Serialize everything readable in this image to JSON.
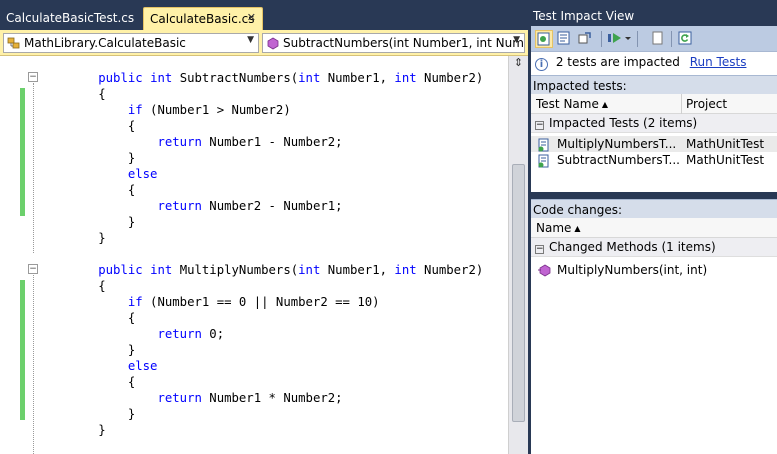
{
  "editor": {
    "tabs": [
      {
        "label": "CalculateBasicTest.cs",
        "active": false
      },
      {
        "label": "CalculateBasic.cs",
        "active": true
      }
    ],
    "tab_close_glyph": "✕",
    "nav": {
      "class_combo": "MathLibrary.CalculateBasic",
      "member_combo": "SubtractNumbers(int Number1, int Numb"
    },
    "code_lines": [
      "        public int SubtractNumbers(int Number1, int Number2)",
      "        {",
      "            if (Number1 > Number2)",
      "            {",
      "                return Number1 - Number2;",
      "            }",
      "            else",
      "            {",
      "                return Number2 - Number1;",
      "            }",
      "        }",
      "",
      "        public int MultiplyNumbers(int Number1, int Number2)",
      "        {",
      "            if (Number1 == 0 || Number2 == 10)",
      "            {",
      "                return 0;",
      "            }",
      "            else",
      "            {",
      "                return Number1 * Number2;",
      "            }",
      "        }"
    ],
    "keywords": [
      "public",
      "int",
      "if",
      "return",
      "else"
    ],
    "colors": {
      "keyword": "#0000ff",
      "changed_marker": "#6cd06c",
      "active_tab": "#fff1a8",
      "chrome": "#293955"
    }
  },
  "panel": {
    "title": "Test Impact View",
    "info": {
      "icon": "info-icon",
      "icon_glyph": "i",
      "message": "2 tests are impacted",
      "link": "Run Tests"
    },
    "impacted_tests": {
      "section_label": "Impacted tests:",
      "columns": [
        "Test Name",
        "Project"
      ],
      "sort_glyph": "▲",
      "group_label": "Impacted Tests (2 items)",
      "group_glyph": "−",
      "rows": [
        {
          "name": "MultiplyNumbersT...",
          "project": "MathUnitTest",
          "icon": "test-icon"
        },
        {
          "name": "SubtractNumbersT...",
          "project": "MathUnitTest",
          "icon": "test-icon"
        }
      ]
    },
    "code_changes": {
      "section_label": "Code changes:",
      "columns": [
        "Name"
      ],
      "sort_glyph": "▲",
      "group_label": "Changed Methods (1 items)",
      "group_glyph": "−",
      "rows": [
        {
          "name": "MultiplyNumbers(int, int)",
          "icon": "method-icon"
        }
      ]
    },
    "toolbar_icons": [
      "show-impacted-tests-icon",
      "show-code-changes-icon",
      "show-call-hierarchy-icon",
      "run-tests-icon",
      "dropdown-icon",
      "copy-icon",
      "refresh-icon"
    ]
  }
}
